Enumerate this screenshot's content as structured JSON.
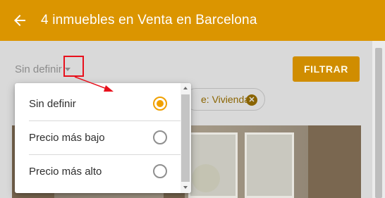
{
  "appbar": {
    "title": "4 inmuebles en Venta en Barcelona",
    "back_icon": "arrow-left-icon",
    "color": "#db9500"
  },
  "toolbar": {
    "sort_value": "Sin definir",
    "filter_label": "FILTRAR"
  },
  "chip": {
    "label": "e: Vivienda"
  },
  "sort_menu": {
    "items": [
      {
        "label": "Sin definir",
        "selected": true
      },
      {
        "label": "Precio más bajo",
        "selected": false
      },
      {
        "label": "Precio más alto",
        "selected": false
      }
    ],
    "accent": "#f0a000"
  },
  "annotation": {
    "color": "#e8101c"
  }
}
